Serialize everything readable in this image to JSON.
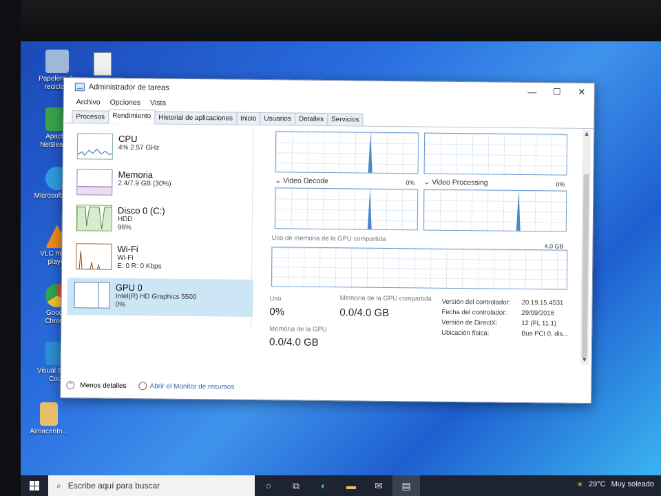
{
  "desktop": {
    "icons": [
      {
        "label": "Papelera de reciclaje",
        "icon": "recycle-bin-icon",
        "color": "#9fb8d8"
      },
      {
        "label": "Apache NetBeans I",
        "icon": "netbeans-icon",
        "color": "#3aa34a"
      },
      {
        "label": "Microsoft Edge",
        "icon": "edge-icon",
        "color": "#2e9be0"
      },
      {
        "label": "VLC media player",
        "icon": "vlc-icon",
        "color": "#f08a1c"
      },
      {
        "label": "Google Chrome",
        "icon": "chrome-icon",
        "color": "#e24b3b"
      },
      {
        "label": "Visual Studio Code",
        "icon": "vscode-icon",
        "color": "#2c8fd6"
      },
      {
        "label": "AlmacenIn...",
        "icon": "folder-icon",
        "color": "#e8c06a"
      }
    ]
  },
  "window": {
    "title": "Administrador de tareas",
    "controls": {
      "minimize": "—",
      "maximize": "☐",
      "close": "✕"
    },
    "menu": [
      "Archivo",
      "Opciones",
      "Vista"
    ],
    "tabs": [
      "Procesos",
      "Rendimiento",
      "Historial de aplicaciones",
      "Inicio",
      "Usuarios",
      "Detalles",
      "Servicios"
    ],
    "active_tab": "Rendimiento"
  },
  "resources": [
    {
      "name": "CPU",
      "sub1": "4% 2.57 GHz",
      "sub2": "",
      "sub3": ""
    },
    {
      "name": "Memoria",
      "sub1": "2.4/7.9 GB (30%)",
      "sub2": "",
      "sub3": ""
    },
    {
      "name": "Disco 0 (C:)",
      "sub1": "HDD",
      "sub2": "96%",
      "sub3": ""
    },
    {
      "name": "Wi-Fi",
      "sub1": "Wi-Fi",
      "sub2": "E: 0 R: 0 Kbps",
      "sub3": ""
    },
    {
      "name": "GPU 0",
      "sub1": "Intel(R) HD Graphics 5500",
      "sub2": "0%",
      "sub3": ""
    }
  ],
  "gpu": {
    "video_decode_label": "Video Decode",
    "video_decode_pct": "0%",
    "video_processing_label": "Video Processing",
    "video_processing_pct": "0%",
    "shared_mem_label": "Uso de memoria de la GPU compartida",
    "shared_mem_max": "4.0 GB",
    "uso_label": "Uso",
    "uso_value": "0%",
    "shared_mem_stat_label": "Memoria de la GPU compartida",
    "shared_mem_stat_value": "0.0/4.0 GB",
    "gpu_mem_label": "Memoria de la GPU",
    "gpu_mem_value": "0.0/4.0 GB",
    "props": [
      {
        "k": "Versión del controlador:",
        "v": "20.19.15.4531"
      },
      {
        "k": "Fecha del controlador:",
        "v": "29/09/2016"
      },
      {
        "k": "Versión de DirectX:",
        "v": "12 (FL 11.1)"
      },
      {
        "k": "Ubicación física:",
        "v": "Bus PCI 0, dis..."
      }
    ]
  },
  "footer": {
    "less_details": "Menos detalles",
    "resource_monitor": "Abrir el Monitor de recursos"
  },
  "taskbar": {
    "search_placeholder": "Escribe aquí para buscar",
    "weather": "29°C",
    "weather_desc": "Muy soleado"
  }
}
